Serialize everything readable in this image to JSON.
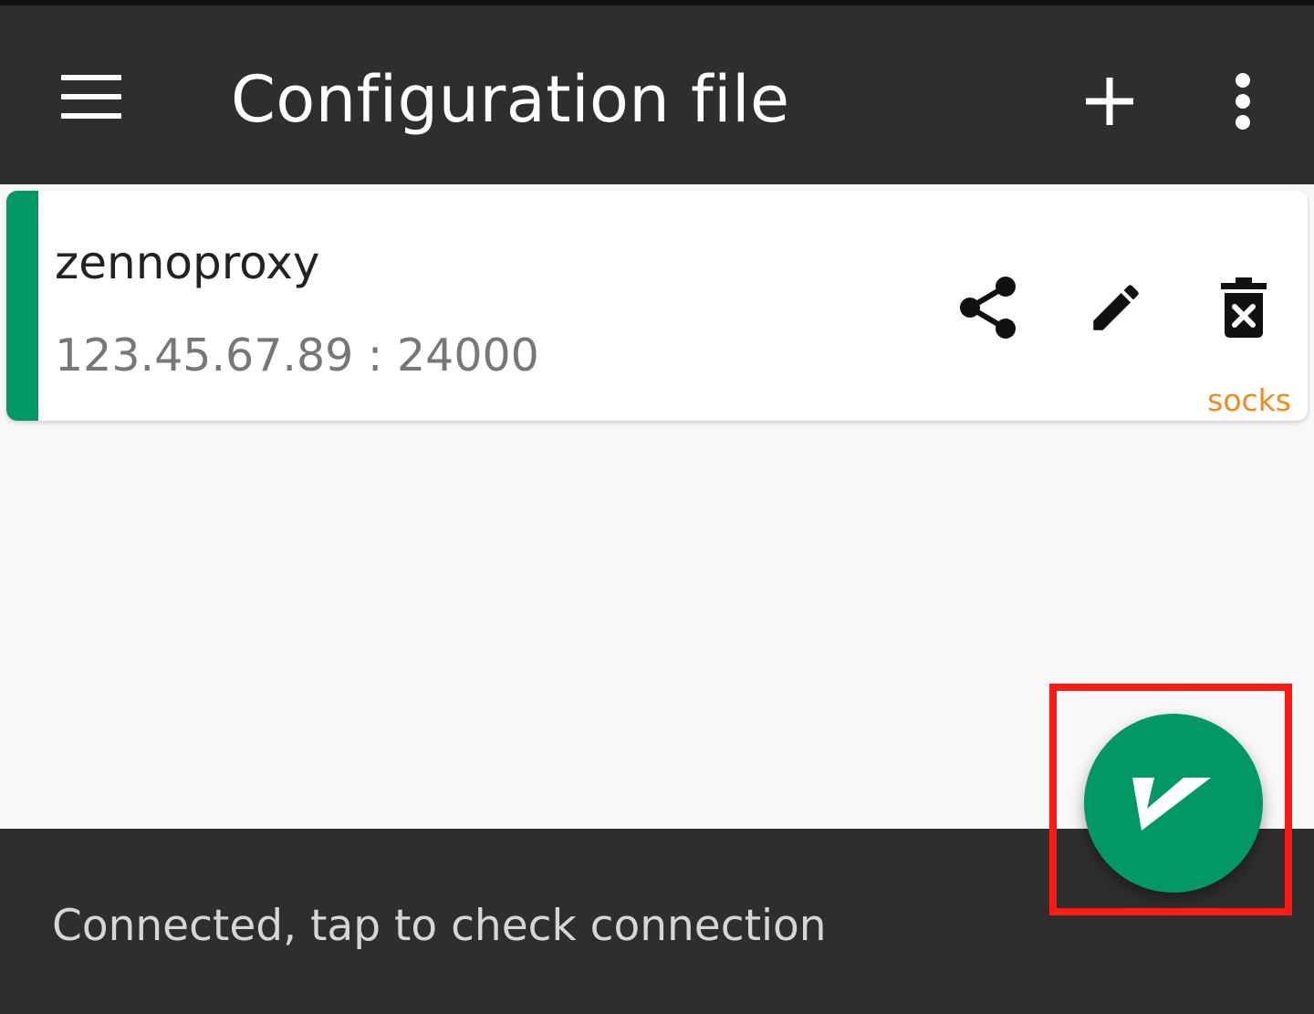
{
  "app_bar": {
    "title": "Configuration file",
    "menu_icon": "hamburger-menu-icon",
    "add_icon": "plus-icon",
    "more_icon": "more-vertical-icon"
  },
  "server_list": [
    {
      "name": "zennoproxy",
      "address": "123.45.67.89 : 24000",
      "protocol": "socks",
      "selected": true,
      "actions": [
        "share-icon",
        "edit-pencil-icon",
        "delete-trash-icon"
      ]
    }
  ],
  "bottom_bar": {
    "status": "Connected, tap to check connection"
  },
  "fab": {
    "icon": "v2ray-v-logo-icon",
    "state": "connected"
  },
  "colors": {
    "app_bar_bg": "#2e2e2e",
    "accent_green": "#019866",
    "protocol_orange": "#f08a1a",
    "highlight_red": "#ff1a14",
    "page_bg": "#f8f8f8"
  }
}
